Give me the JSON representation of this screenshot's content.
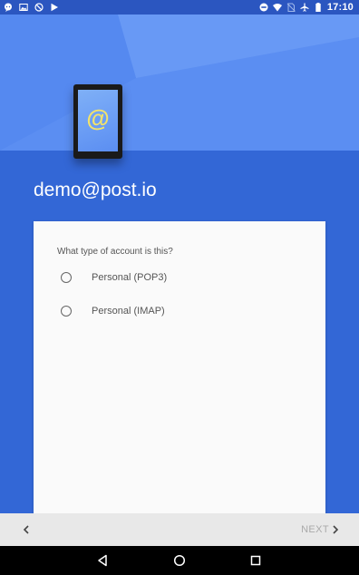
{
  "status_bar": {
    "time": "17:10",
    "left_icons": [
      "chat-icon",
      "image-icon",
      "blocked-icon",
      "play-store-icon"
    ],
    "right_icons": [
      "do-not-disturb-icon",
      "wifi-icon",
      "no-sim-icon",
      "airplane-mode-icon",
      "battery-icon"
    ]
  },
  "header": {
    "illustration": "tablet-email-icon",
    "illustration_glyph": "@",
    "account_email": "demo@post.io"
  },
  "card": {
    "question": "What type of account is this?",
    "options": [
      {
        "label": "Personal (POP3)",
        "selected": false
      },
      {
        "label": "Personal (IMAP)",
        "selected": false
      }
    ]
  },
  "nav_bar": {
    "back_icon": "chevron-left-icon",
    "next_label": "NEXT",
    "next_icon": "chevron-right-icon",
    "next_enabled": false
  },
  "system_nav": {
    "buttons": [
      "back-triangle-icon",
      "home-circle-icon",
      "recents-square-icon"
    ]
  },
  "colors": {
    "primary": "#3367d6",
    "header_light": "#5b8ef2",
    "status_bar": "#2b56c0",
    "card": "#fafafa",
    "nav_bar": "#e8e8e8",
    "accent_at": "#f3e36a"
  }
}
